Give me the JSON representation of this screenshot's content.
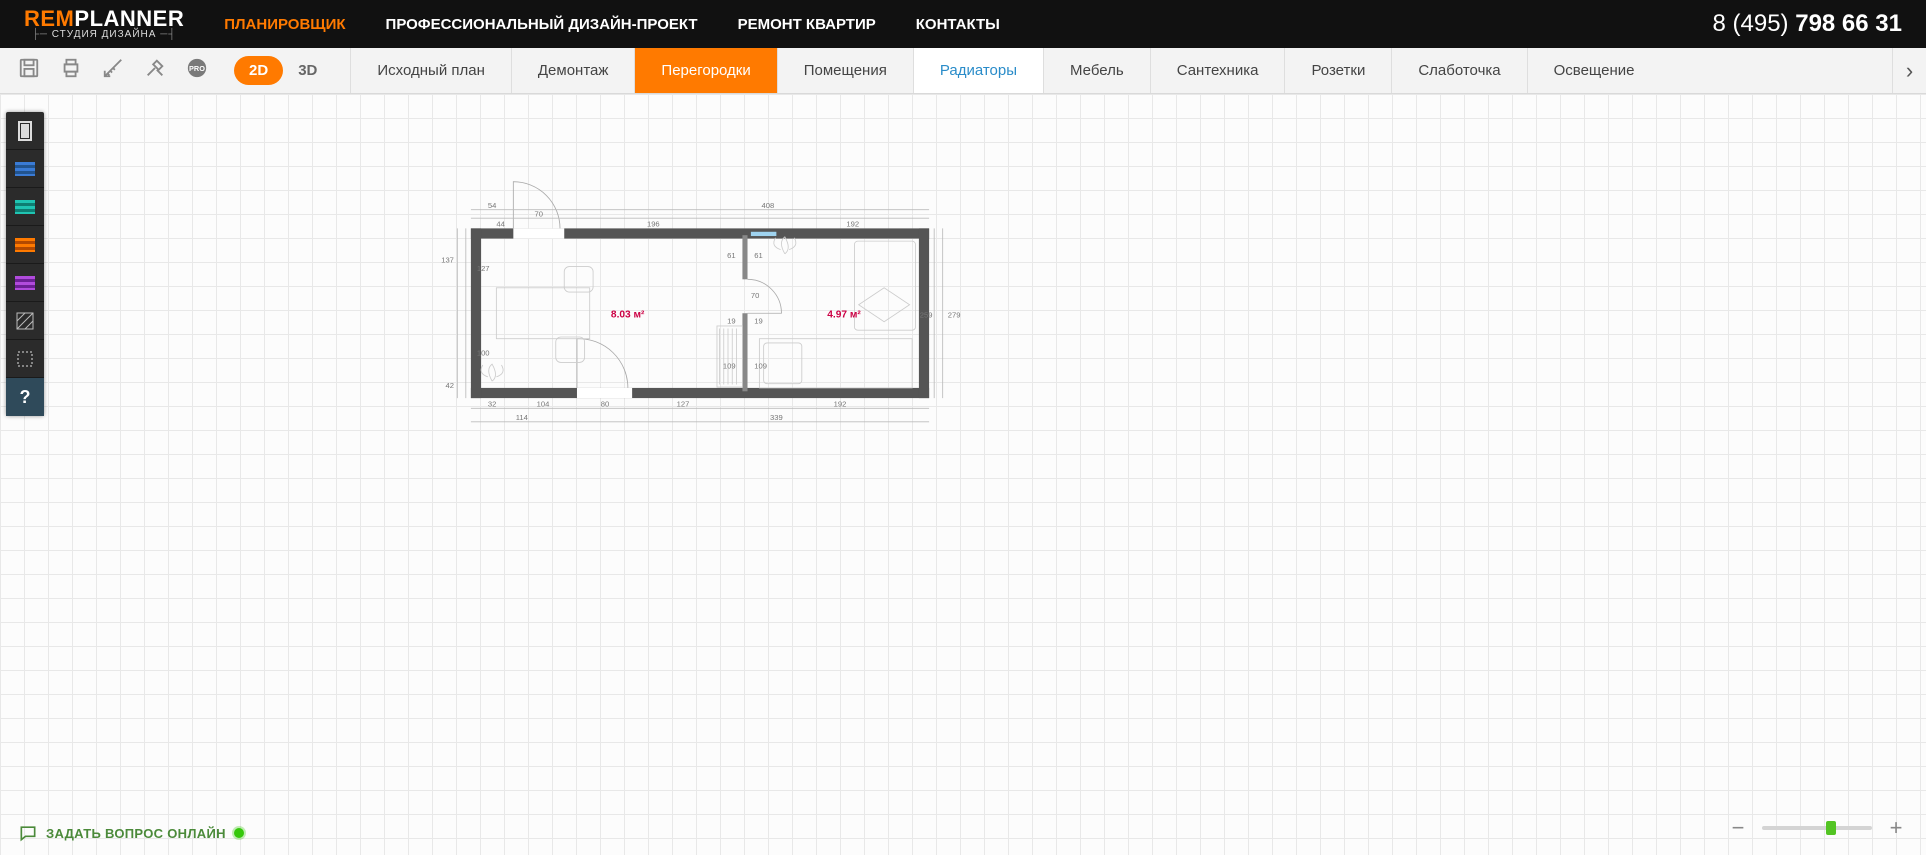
{
  "logo": {
    "line1a": "REM",
    "line1b": "PLANNER",
    "line2": "СТУДИЯ ДИЗАЙНА"
  },
  "nav": {
    "items": [
      {
        "label": "ПЛАНИРОВЩИК",
        "active": true
      },
      {
        "label": "ПРОФЕССИОНАЛЬНЫЙ ДИЗАЙН-ПРОЕКТ"
      },
      {
        "label": "РЕМОНТ КВАРТИР"
      },
      {
        "label": "КОНТАКТЫ"
      }
    ]
  },
  "phone": {
    "prefix": "8 (495) ",
    "number": "798 66 31"
  },
  "view": {
    "mode2d": "2D",
    "mode3d": "3D",
    "active": "2D"
  },
  "tabs": [
    {
      "label": "Исходный план"
    },
    {
      "label": "Демонтаж"
    },
    {
      "label": "Перегородки",
      "active": true
    },
    {
      "label": "Помещения"
    },
    {
      "label": "Радиаторы",
      "highlight": true
    },
    {
      "label": "Мебель"
    },
    {
      "label": "Сантехника"
    },
    {
      "label": "Розетки"
    },
    {
      "label": "Слаботочка"
    },
    {
      "label": "Освещение"
    }
  ],
  "palette_help": "?",
  "rooms": {
    "a": "8.03 м²",
    "b": "4.97 м²"
  },
  "dims": {
    "top_54": "54",
    "top_70": "70",
    "top_408": "408",
    "t44": "44",
    "t196": "196",
    "t192": "192",
    "l137": "137",
    "l127": "127",
    "l100": "100",
    "l42": "42",
    "b32": "32",
    "b104": "104",
    "b80": "80",
    "b127": "127",
    "b192": "192",
    "bb114": "114",
    "bb339": "339",
    "m61a": "61",
    "m61b": "61",
    "m70": "70",
    "m19a": "19",
    "m19b": "19",
    "m109a": "109",
    "m109b": "109",
    "r259": "259",
    "r279": "279"
  },
  "chat": {
    "label": "ЗАДАТЬ ВОПРОС ОНЛАЙН"
  },
  "zoom": {
    "minus": "−",
    "plus": "+"
  }
}
